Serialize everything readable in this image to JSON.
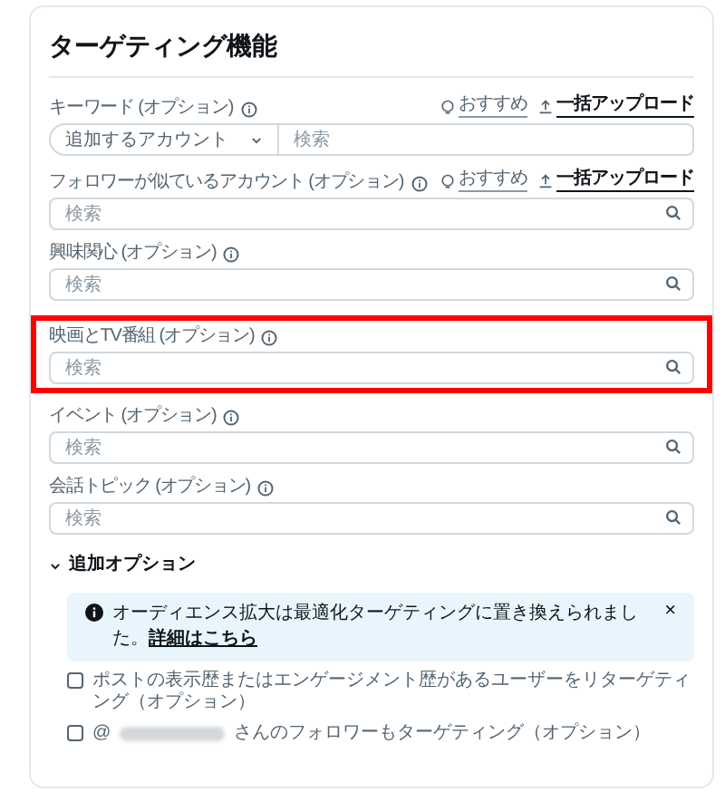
{
  "title": "ターゲティング機能",
  "fields": [
    {
      "label": "キーワード (オプション)",
      "kind": "dropdown",
      "dropdown_value": "追加するアカウント",
      "placeholder": "検索",
      "highlighted": false,
      "actions": [
        {
          "kind": "recommend",
          "label": "おすすめ"
        },
        {
          "kind": "upload",
          "label": "一括アップロード"
        }
      ]
    },
    {
      "label": "フォロワーが似ているアカウント (オプション)",
      "kind": "search",
      "placeholder": "検索",
      "highlighted": false,
      "actions": [
        {
          "kind": "recommend",
          "label": "おすすめ"
        },
        {
          "kind": "upload",
          "label": "一括アップロード"
        }
      ]
    },
    {
      "label": "興味関心 (オプション)",
      "kind": "search",
      "placeholder": "検索",
      "highlighted": false
    },
    {
      "label": "映画とTV番組 (オプション)",
      "kind": "search",
      "placeholder": "検索",
      "highlighted": true
    },
    {
      "label": "イベント (オプション)",
      "kind": "search",
      "placeholder": "検索",
      "highlighted": false
    },
    {
      "label": "会話トピック (オプション)",
      "kind": "search",
      "placeholder": "検索",
      "highlighted": false
    }
  ],
  "additional": {
    "label": "追加オプション",
    "expanded": true,
    "notice": {
      "text": "オーディエンス拡大は最適化ターゲティングに置き換えられました。",
      "link": "詳細はこちら",
      "close": "×"
    },
    "checkboxes": [
      {
        "kind": "plain",
        "label": "ポストの表示歴またはエンゲージメント歴があるユーザーをリターゲティング（オプション）",
        "checked": false
      },
      {
        "kind": "mention",
        "prefix": "@",
        "label": "さんのフォロワーもターゲティング（オプション）",
        "checked": false
      }
    ]
  }
}
